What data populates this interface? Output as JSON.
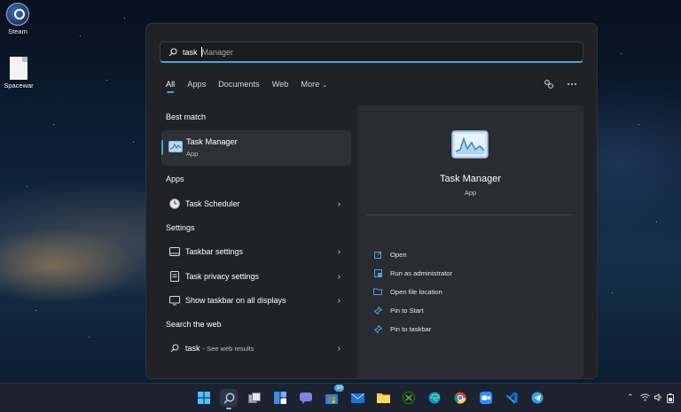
{
  "desktop": {
    "icons": [
      {
        "label": "Steam",
        "icon": "steam-icon"
      },
      {
        "label": "Spacewar",
        "icon": "file-icon"
      }
    ]
  },
  "search": {
    "typed": "task",
    "suggestion": "Manager"
  },
  "tabs": [
    "All",
    "Apps",
    "Documents",
    "Web",
    "More"
  ],
  "sections": {
    "best_match": "Best match",
    "apps": "Apps",
    "settings": "Settings",
    "search_web": "Search the web"
  },
  "best_match": {
    "title": "Task Manager",
    "subtitle": "App"
  },
  "apps": [
    {
      "label": "Task Scheduler",
      "icon": "clock-icon"
    }
  ],
  "settings": [
    {
      "label": "Taskbar settings",
      "icon": "taskbar-icon"
    },
    {
      "label": "Task privacy settings",
      "icon": "privacy-icon"
    },
    {
      "label": "Show taskbar on all displays",
      "icon": "monitor-icon"
    }
  ],
  "web": {
    "query": "task",
    "sub": "- See web results"
  },
  "preview": {
    "title": "Task Manager",
    "subtitle": "App",
    "actions": [
      {
        "label": "Open",
        "icon": "open-icon"
      },
      {
        "label": "Run as administrator",
        "icon": "admin-shield-icon"
      },
      {
        "label": "Open file location",
        "icon": "folder-icon"
      },
      {
        "label": "Pin to Start",
        "icon": "pin-icon"
      },
      {
        "label": "Pin to taskbar",
        "icon": "pin-icon"
      }
    ]
  },
  "taskbar": {
    "mail_badge": "10",
    "icons": [
      "windows-start-icon",
      "search-icon",
      "task-view-icon",
      "widgets-icon",
      "teams-chat-icon",
      "store-icon",
      "mail-icon",
      "file-explorer-icon",
      "xbox-icon",
      "edge-icon",
      "chrome-icon",
      "zoom-icon",
      "vscode-icon",
      "telegram-icon"
    ]
  },
  "colors": {
    "accent": "#4aa2e0",
    "panel": "#202226",
    "preview": "#2a2c31"
  }
}
